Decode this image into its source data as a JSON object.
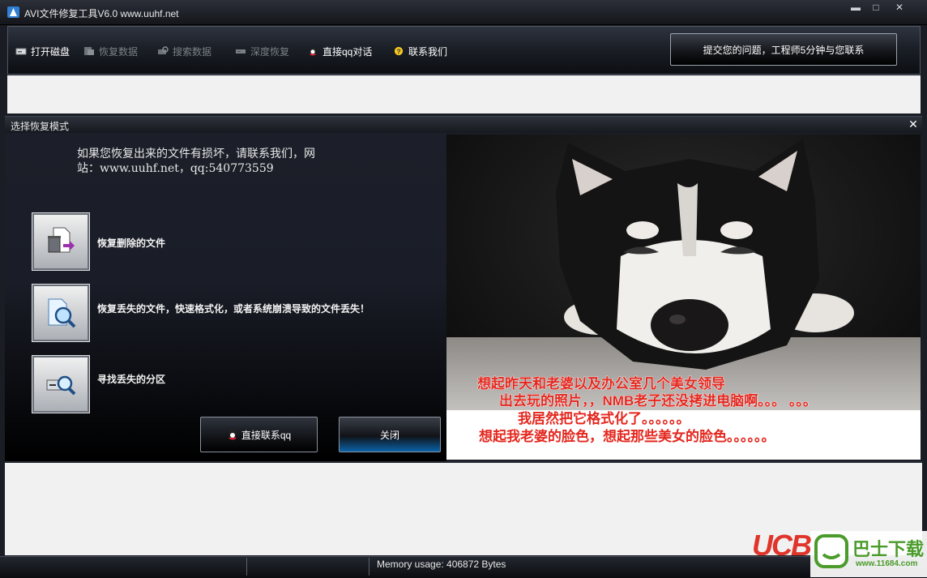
{
  "window": {
    "title": "AVI文件修复工具V6.0 www.uuhf.net",
    "controls": {
      "minimize": "▬",
      "maximize": "□",
      "close": "✕"
    }
  },
  "toolbar": {
    "items": [
      {
        "label": "打开磁盘",
        "icon": "disk-icon",
        "enabled": true
      },
      {
        "label": "恢复数据",
        "icon": "restore-icon",
        "enabled": false
      },
      {
        "label": "搜索数据",
        "icon": "search-data-icon",
        "enabled": false
      },
      {
        "label": "深度恢复",
        "icon": "deep-restore-icon",
        "enabled": false
      },
      {
        "label": "直接qq对话",
        "icon": "qq-icon",
        "enabled": true
      },
      {
        "label": "联系我们",
        "icon": "help-icon",
        "enabled": true
      }
    ],
    "submit_label": "提交您的问题，工程师5分钟与您联系"
  },
  "dialog": {
    "title": "选择恢复模式",
    "close_glyph": "✕",
    "notice_line1": "如果您恢复出来的文件有损坏，请联系我们，网",
    "notice_line2": "站：www.uuhf.net，qq:540773559",
    "options": [
      {
        "label": "恢复删除的文件",
        "icon": "recycle-file-icon"
      },
      {
        "label": "恢复丢失的文件，快速格式化，或者系统崩溃导致的文件丢失！",
        "icon": "magnifier-file-icon"
      },
      {
        "label": "寻找丢失的分区",
        "icon": "drive-search-icon"
      }
    ],
    "qq_button_label": "直接联系qq",
    "close_button_label": "关闭",
    "image_caption": [
      "想起昨天和老婆以及办公室几个美女领导",
      "出去玩的照片，，NMB老子还没拷进电脑啊。。。 。。。",
      "我居然把它格式化了。。。。。。",
      "想起我老婆的脸色，想起那些美女的脸色。。。。。。"
    ]
  },
  "statusbar": {
    "memory": "Memory usage: 406872 Bytes"
  },
  "watermark": {
    "logo": "UCB",
    "name": "巴士下载",
    "url": "www.11684.com"
  },
  "colors": {
    "accent_blue": "#0a62a8",
    "caption_red": "#e4271e",
    "watermark_green": "#4a9b2a"
  }
}
